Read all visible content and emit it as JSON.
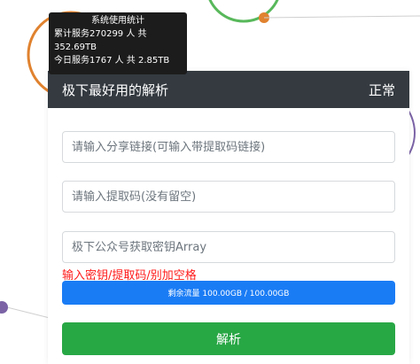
{
  "colors": {
    "header_bg": "#343a40",
    "progress": "#1a7cf5",
    "button": "#28a745",
    "hint": "#ff1a1a",
    "deco_orange": "#e0822f",
    "deco_green": "#58b85b",
    "deco_purple": "#7b63a6"
  },
  "tooltip": {
    "title": "系统使用统计",
    "line1": "累计服务270299 人 共",
    "line2": "352.69TB",
    "line3": "今日服务1767 人 共 2.85TB"
  },
  "card": {
    "title": "极下最好用的解析",
    "status": "正常"
  },
  "form": {
    "share_link_placeholder": "请输入分享链接(可输入带提取码链接)",
    "extract_code_placeholder": "请输入提取码(没有留空)",
    "key_placeholder": "极下公众号获取密钥Array",
    "hint": "输入密钥/提取码/别加空格",
    "quota_text": "剩余流量 100.00GB / 100.00GB",
    "quota_fraction": 1.0,
    "submit_label": "解析"
  }
}
